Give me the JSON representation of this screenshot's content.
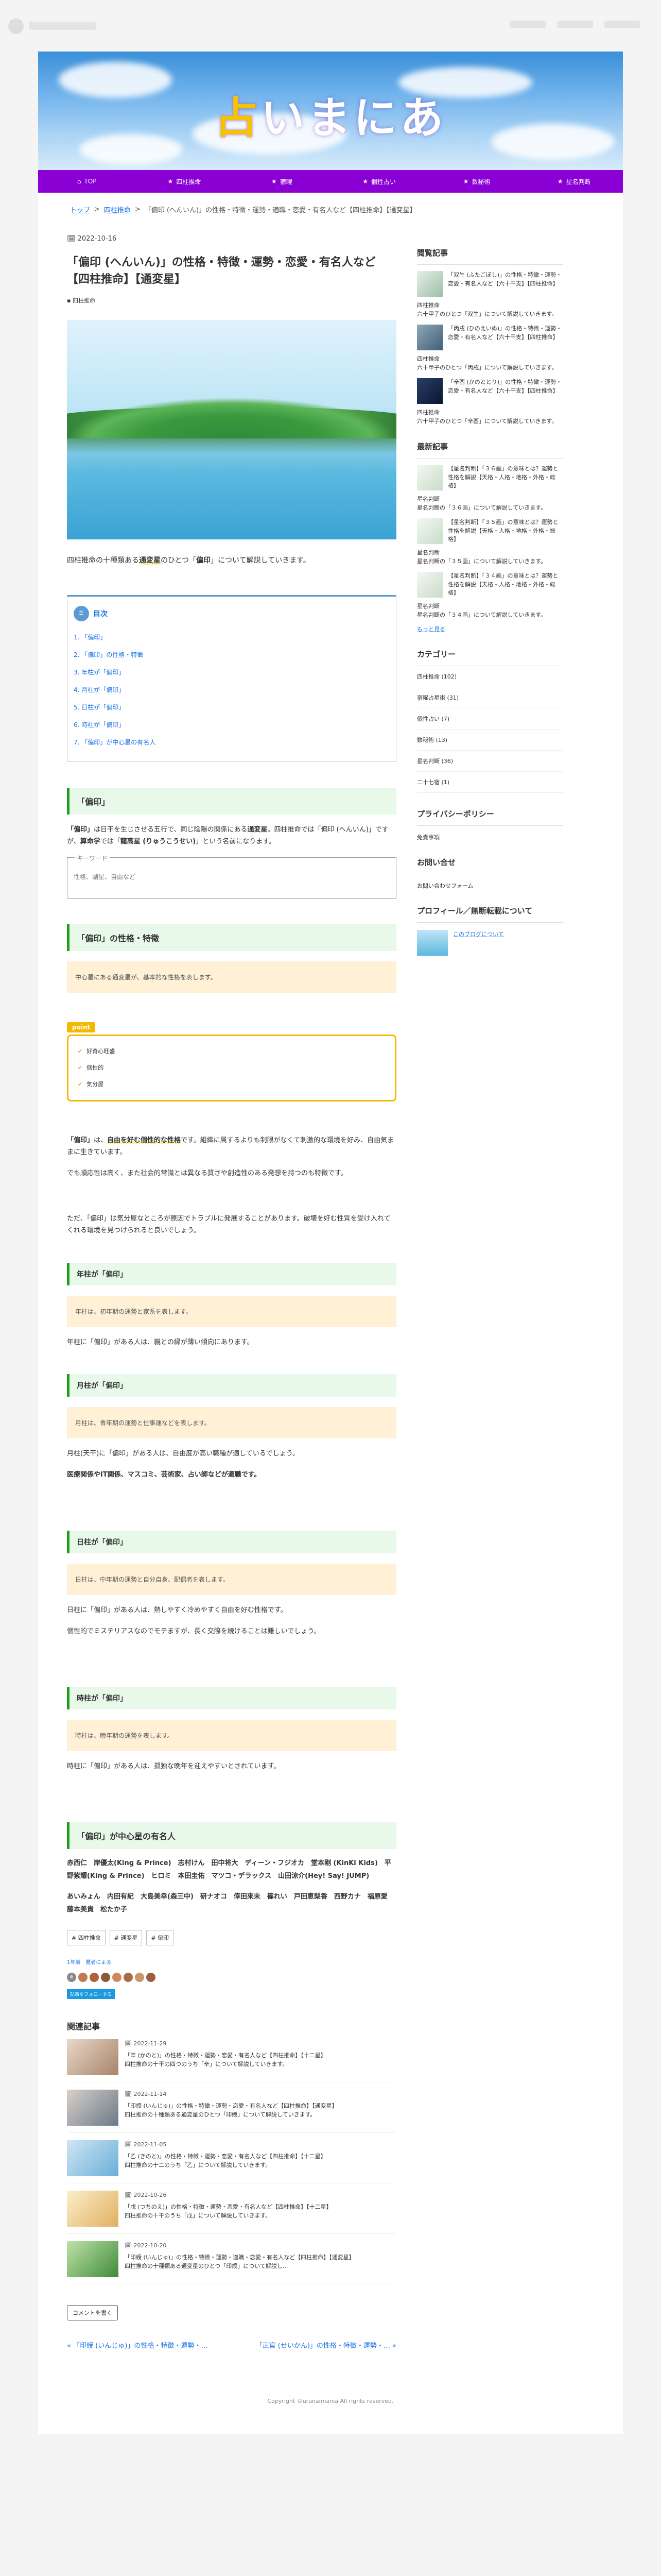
{
  "header": {
    "site_title_first": "占",
    "site_title_rest": "いまにあ"
  },
  "gnav": [
    {
      "icon": "⌂",
      "label": "TOP"
    },
    {
      "icon": "★",
      "label": "四柱推命"
    },
    {
      "icon": "★",
      "label": "宿曜"
    },
    {
      "icon": "★",
      "label": "個性占い"
    },
    {
      "icon": "★",
      "label": "数秘術"
    },
    {
      "icon": "★",
      "label": "星名判断"
    }
  ],
  "breadcrumb": {
    "home": "トップ",
    "sep": ">",
    "cat": "四柱推命",
    "current": "「偏印 (へんいん)」の性格・特徴・運勢・適職・恋愛・有名人など【四柱推命】【通変星】"
  },
  "article": {
    "date": "2022-10-16",
    "title": "「偏印 (へんいん)」の性格・特徴・運勢・恋愛・有名人など【四柱推命】【通変星】",
    "category": "四柱推命",
    "intro_a": "四柱推命の十種類ある",
    "intro_mark": "通変星",
    "intro_b": "のひとつ「",
    "intro_name": "偏印",
    "intro_c": "」について解説していきます。",
    "toc_title": "目次",
    "toc": [
      "1. 「偏印」",
      "2. 「偏印」の性格・特徴",
      "3. 年柱が「偏印」",
      "4. 月柱が「偏印」",
      "5. 日柱が「偏印」",
      "6. 時柱が「偏印」",
      "7. 「偏印」が中心星の有名人"
    ],
    "s1_title": "「偏印」",
    "s1_p_a": "「偏印」",
    "s1_p_b": "は日干を生じさせる五行で、同じ陰陽の関係にある",
    "s1_p_c": "通変星",
    "s1_p_d": "。四柱推命では「偏印 (へんいん)」ですが、",
    "s1_p_e": "算命学",
    "s1_p_f": "では「",
    "s1_p_g": "龍高星 (りゅうこうせい)",
    "s1_p_h": "」という名前になります。",
    "search_label": "キーワード",
    "search_placeholder": "性格、副星、自由など",
    "s2_title": "「偏印」の性格・特徴",
    "s2_note": "中心星にある通変星が、基本的な性格を表します。",
    "point_tag": "point",
    "points": [
      "好奇心旺盛",
      "個性的",
      "気分屋"
    ],
    "s2_p1_a": "「偏印」",
    "s2_p1_b": "は、",
    "s2_p1_c": "自由を好む個性的な性格",
    "s2_p1_d": "です。組織に属するよりも制限がなくて刺激的な環境を好み、自由気ままに生きています。",
    "s2_p2": "でも順応性は高く、また社会的常識とは異なる質さや創造性のある発想を持つのも特徴です。",
    "s2_p3": "ただ、「偏印」は気分屋なところが原因でトラブルに発展することがあります。破壊を好む性質を受け入れてくれる環境を見つけられると良いでしょう。",
    "s3_title": "年柱が「偏印」",
    "s3_note": "年柱は、初年期の運勢と家系を表します。",
    "s3_p": "年柱に「偏印」がある人は、親との縁が薄い傾向にあります。",
    "s4_title": "月柱が「偏印」",
    "s4_note": "月柱は、青年期の運勢と仕事運などを表します。",
    "s4_p1": "月柱(天干)に「偏印」がある人は、自由度が高い職種が適しているでしょう。",
    "s4_p2": "医療関係やIT関係、マスコミ、芸術家、占い師などが適職です。",
    "s5_title": "日柱が「偏印」",
    "s5_note": "日柱は、中年期の運勢と自分自身、配偶者を表します。",
    "s5_p1": "日柱に「偏印」がある人は、熱しやすく冷めやすく自由を好む性格です。",
    "s5_p2": "個性的でミステリアスなのでモテますが、長く交際を続けることは難しいでしょう。",
    "s6_title": "時柱が「偏印」",
    "s6_note": "時柱は、晩年期の運勢を表します。",
    "s6_p": "時柱に「偏印」がある人は、孤独な晩年を迎えやすいとされています。",
    "s7_title": "「偏印」が中心星の有名人",
    "celebs1": "赤西仁　岸優太(King & Prince)　志村けん　田中将大　ディーン・フジオカ　堂本剛 (KinKi Kids)　平野紫耀(King & Prince)　ヒロミ　本田圭佑　マツコ・デラックス　山田涼介(Hey! Say! JUMP)",
    "celebs2": "あいみょん　内田有紀　大島美幸(森三中)　研ナオコ　倖田來未　篠れい　戸田恵梨香　西野カナ　福原愛　藤本美貴　松たか子",
    "tags": [
      "# 四柱推命",
      "# 通変星",
      "# 偏印"
    ],
    "meta_a": "1年前",
    "meta_b": "匿者による",
    "follow": "記事をフォローする",
    "related_title": "関連記事",
    "related": [
      {
        "date": "2022-11-29",
        "title": "「辛 (かのと)」の性格・特徴・運勢・恋愛・有名人など【四柱推命】【十二星】",
        "desc": "四柱推命の十干の四つのうち「辛」について解説していきます。"
      },
      {
        "date": "2022-11-14",
        "title": "「印綬 (いんじゅ)」の性格・特徴・運勢・恋愛・有名人など【四柱推命】【通変星】",
        "desc": "四柱推命の十種類ある通変星のひとつ「印綬」について解説していきます。"
      },
      {
        "date": "2022-11-05",
        "title": "「乙 (きのと)」の性格・特徴・運勢・恋愛・有名人など【四柱推命】【十二星】",
        "desc": "四柱推命の十二のうち「乙」について解説していきます。"
      },
      {
        "date": "2022-10-26",
        "title": "「戊 (つちのえ)」の性格・特徴・運勢・恋愛・有名人など【四柱推命】【十二星】",
        "desc": "四柱推命の十干のうち「戊」について解説していきます。"
      },
      {
        "date": "2022-10-20",
        "title": "「印綬 (いんじゅ)」の性格・特徴・運勢・適職・恋愛・有名人など【四柱推命】【通変星】",
        "desc": "四柱推命の十種類ある通変星のひとつ「印綬」について解説し..."
      }
    ],
    "comment_btn": "コメントを書く",
    "prev": "« 「印綬 (いんじゅ)」の性格・特徴・運勢・…",
    "next": "「正官 (せいかん)」の性格・特徴・運勢・… »"
  },
  "sidebar": {
    "popular_title": "閲覧記事",
    "popular": [
      {
        "title": "「双生 (ふたごぼし)」の性格・特徴・運勢・恋愛・有名人など【六十干支】【四柱推命】",
        "cat": "四柱推命",
        "desc": "六十甲子のひとつ「双生」について解説していきます。"
      },
      {
        "title": "「丙戌 (ひのえいぬ)」の性格・特徴・運勢・恋愛・有名人など【六十干支】【四柱推命】",
        "cat": "四柱推命",
        "desc": "六十甲子のひとつ「丙戌」について解説していきます。"
      },
      {
        "title": "「辛酉 (かのととり)」の性格・特徴・運勢・恋愛・有名人など【六十干支】【四柱推命】",
        "cat": "四柱推命",
        "desc": "六十甲子のひとつ「辛酉」について解説していきます。"
      }
    ],
    "recent_title": "最新記事",
    "recent": [
      {
        "title": "【星名判断】「３６画」の意味とは？運勢と性格を解説【天格・人格・地格・外格・総格】",
        "cat": "星名判断",
        "desc": "星名判断の「３６画」について解説していきます。"
      },
      {
        "title": "【星名判断】「３５画」の意味とは？運勢と性格を解説【天格・人格・地格・外格・総格】",
        "cat": "星名判断",
        "desc": "星名判断の「３５画」について解説していきます。"
      },
      {
        "title": "【星名判断】「３４画」の意味とは？運勢と性格を解説【天格・人格・地格・外格・総格】",
        "cat": "星名判断",
        "desc": "星名判断の「３４画」について解説していきます。"
      }
    ],
    "recent_more": "もっと見る",
    "cat_title": "カテゴリー",
    "cats": [
      "四柱推命 (102)",
      "宿曜占星術 (31)",
      "個性占い (7)",
      "数秘術 (13)",
      "星名判断 (36)",
      "二十七宿 (1)"
    ],
    "privacy_title": "プライバシーポリシー",
    "privacy_text": "免責事項",
    "contact_title": "お問い合せ",
    "contact_text": "お問い合わせフォーム",
    "profile_title": "プロフィール／無断転載について",
    "profile_link": "このブログについて"
  },
  "footer": "Copyright ©uranaimania All rights reserved."
}
